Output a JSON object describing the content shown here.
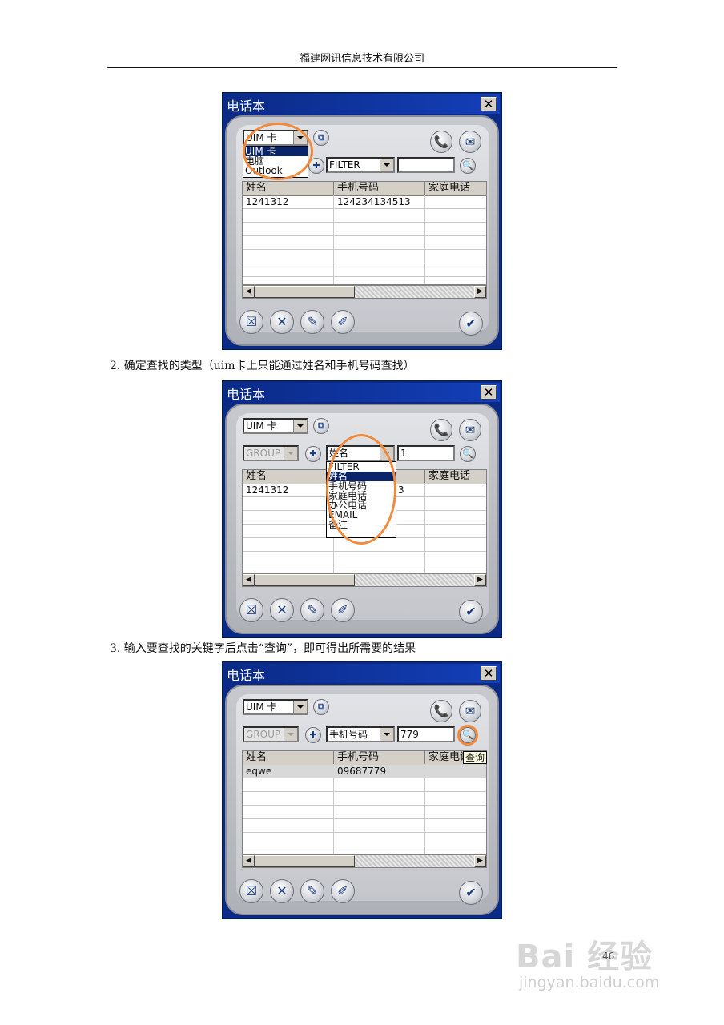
{
  "header": "福建网讯信息技术有限公司",
  "steps": {
    "s2": "2. 确定查找的类型（uim卡上只能通过姓名和手机号码查找）",
    "s3": "3. 输入要查找的关键字后点击“查询”，即可得出所需要的结果"
  },
  "win1": {
    "title": "电话本",
    "close": "✕",
    "source_value": "UIM 卡",
    "source_options": [
      "UIM 卡",
      "电脑",
      "Outlook"
    ],
    "filter_value": "FILTER",
    "search_value": "",
    "columns": [
      "姓名",
      "手机号码",
      "家庭电话"
    ],
    "rows": [
      [
        "1241312",
        "124234134513",
        ""
      ]
    ]
  },
  "win2": {
    "title": "电话本",
    "close": "✕",
    "source_value": "UIM 卡",
    "group_value": "GROUP",
    "filter_value": "姓名",
    "search_value": "1",
    "filter_options": [
      "FILTER",
      "姓名",
      "手机号码",
      "家庭电话",
      "办公电话",
      "EMAIL",
      "备注"
    ],
    "columns": [
      "姓名",
      "手机号码",
      "家庭电话"
    ],
    "rows": [
      [
        "1241312",
        "",
        ""
      ]
    ],
    "partial_cell": "3"
  },
  "win3": {
    "title": "电话本",
    "close": "✕",
    "source_value": "UIM 卡",
    "group_value": "GROUP",
    "filter_value": "手机号码",
    "search_value": "779",
    "columns": [
      "姓名",
      "手机号码",
      "家庭电话"
    ],
    "rows": [
      [
        "eqwe",
        "09687779",
        ""
      ]
    ],
    "tooltip": "查询"
  },
  "icons": {
    "call": "📞",
    "mail": "✉",
    "delete_all": "☒",
    "delete": "✕",
    "add": "✎",
    "edit": "✐",
    "ok": "✔",
    "search": "🔍",
    "copy": "⧉",
    "add_group": "✚",
    "left": "◀",
    "right": "▶"
  },
  "watermark": {
    "brand": "Bai 经验",
    "url": "jingyan.baidu.com",
    "page": "46"
  },
  "colors": {
    "title_bar": "#0a2a86",
    "highlight_ring": "#f08a3c",
    "selection": "#0a246a"
  }
}
